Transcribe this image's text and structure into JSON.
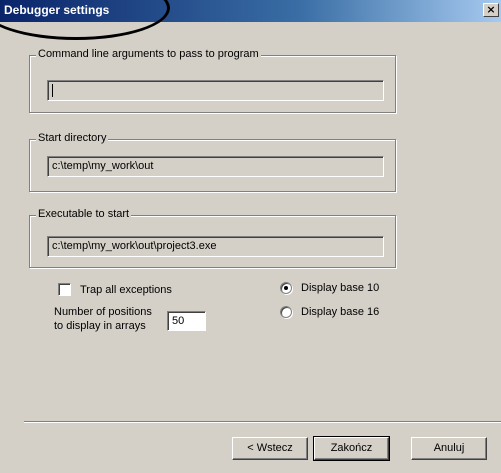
{
  "window": {
    "title": "Debugger settings",
    "close_glyph": "×"
  },
  "groups": {
    "args": {
      "caption": "Command line arguments to pass to program",
      "value": ""
    },
    "start_dir": {
      "caption": "Start directory",
      "value": "c:\\temp\\my_work\\out"
    },
    "exe": {
      "caption": "Executable to start",
      "value": "c:\\temp\\my_work\\out\\project3.exe"
    }
  },
  "options": {
    "trap_label": "Trap all exceptions",
    "trap_checked": false,
    "positions_label_line1": "Number of positions",
    "positions_label_line2": "to display in arrays",
    "positions_value": "50",
    "display_base_10_label": "Display base 10",
    "display_base_16_label": "Display base 16",
    "selected_base": "10"
  },
  "buttons": {
    "back": "< Wstecz",
    "finish": "Zakończ",
    "cancel": "Anuluj"
  },
  "colors": {
    "dialog_bg": "#d4d0c8",
    "title_start": "#0a246a",
    "title_end": "#a6caf0"
  }
}
